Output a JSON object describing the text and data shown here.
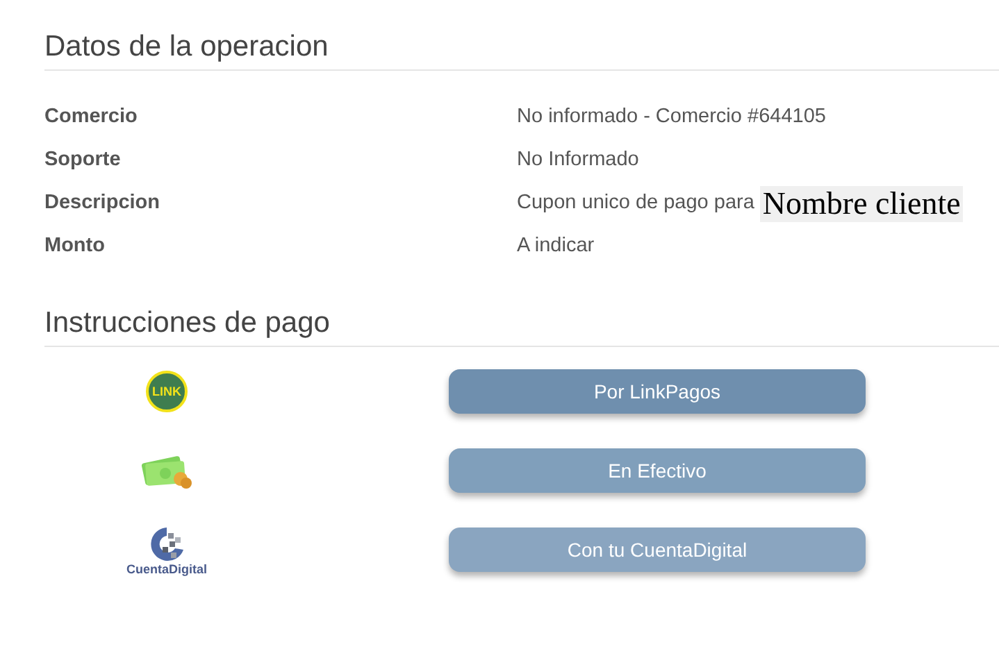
{
  "operation": {
    "title": "Datos de la operacion",
    "rows": [
      {
        "label": "Comercio",
        "value": "No informado - Comercio #644105"
      },
      {
        "label": "Soporte",
        "value": "No Informado"
      },
      {
        "label": "Descripcion",
        "value": "Cupon unico de pago para",
        "overlay": "Nombre cliente"
      },
      {
        "label": "Monto",
        "value": "A indicar"
      }
    ]
  },
  "instructions": {
    "title": "Instrucciones de pago",
    "methods": [
      {
        "kind": "link",
        "logo_text": "LINK",
        "button": "Por LinkPagos",
        "color": "#6f8fae"
      },
      {
        "kind": "cash",
        "button": "En Efectivo",
        "color": "#809fbb"
      },
      {
        "kind": "cuentadigital",
        "logo_text": "CuentaDigital",
        "button": "Con tu CuentaDigital",
        "color": "#8aa5c0"
      }
    ]
  }
}
